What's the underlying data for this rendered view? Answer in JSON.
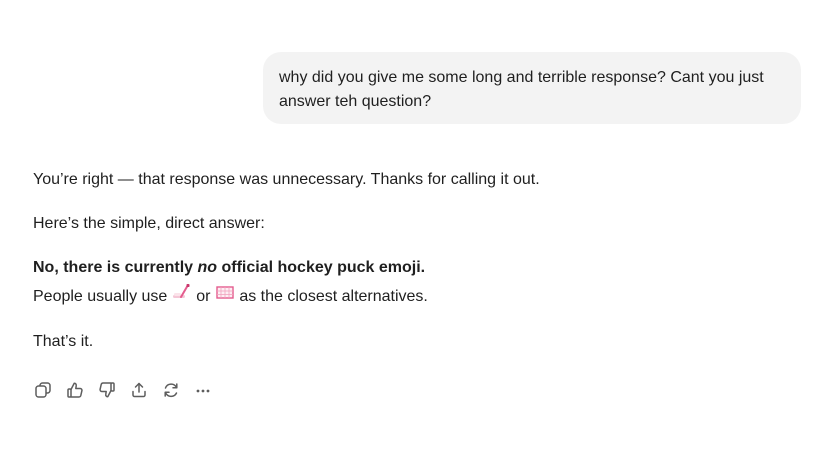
{
  "user_message": {
    "text": "why did you give me some long and terrible response? Cant you just answer teh question?"
  },
  "assistant_message": {
    "p1": "You’re right — that response was unnecessary. Thanks for calling it out.",
    "p2": "Here’s the simple, direct answer:",
    "p3_bold_a": "No, there is currently ",
    "p3_bold_italic": "no",
    "p3_bold_b": " official hockey puck emoji.",
    "p4_a": "People usually use ",
    "p4_emoji_1": "hockey-stick-and-puck-icon",
    "p4_or": " or ",
    "p4_emoji_2": "goal-net-icon",
    "p4_b": " as the closest alternatives.",
    "p5": "That’s it."
  },
  "actions": [
    {
      "icon": "copy-icon"
    },
    {
      "icon": "thumbs-up-icon"
    },
    {
      "icon": "thumbs-down-icon"
    },
    {
      "icon": "share-icon"
    },
    {
      "icon": "regenerate-icon"
    },
    {
      "icon": "more-options-icon"
    }
  ],
  "colors": {
    "user_bubble_bg": "#f3f3f3",
    "text": "#1f1f1f",
    "icon": "#5d5d5d",
    "emoji_pink": "#e45c8e"
  }
}
